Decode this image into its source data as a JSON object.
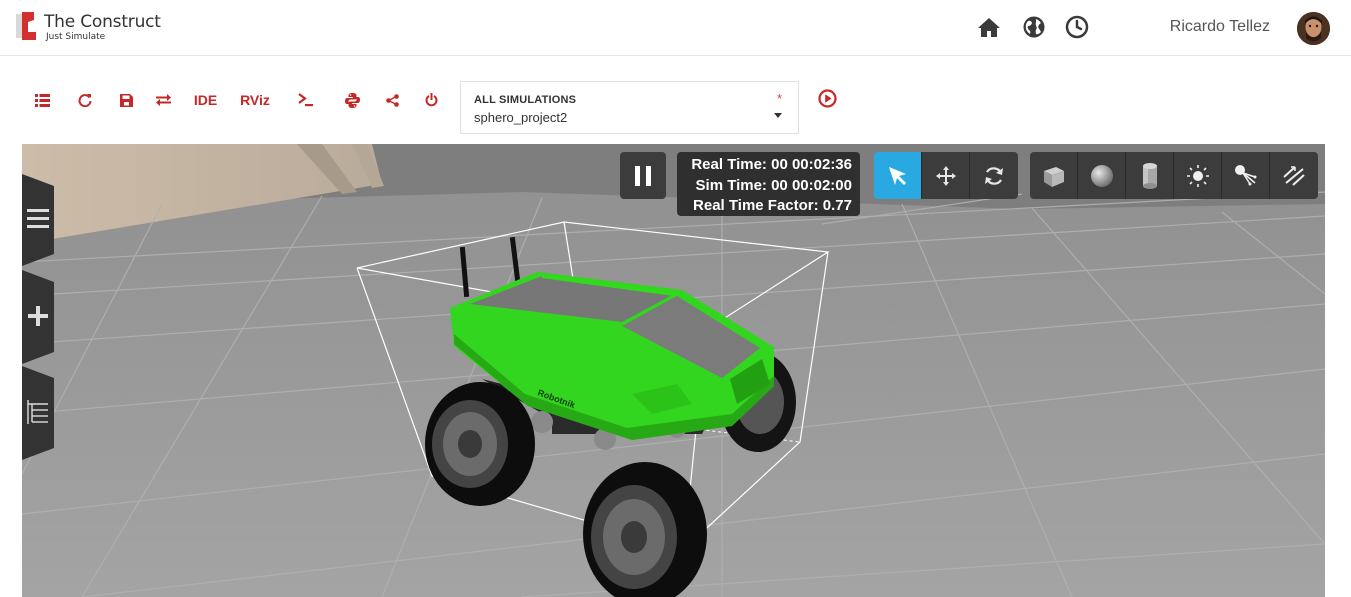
{
  "brand": {
    "title": "The Construct",
    "subtitle": "Just Simulate"
  },
  "header": {
    "icons": [
      "home-icon",
      "globe-icon",
      "clock-icon"
    ],
    "user_name": "Ricardo Tellez"
  },
  "toolbar": {
    "ide_label": "IDE",
    "rviz_label": "RViz",
    "accent": "#c62828",
    "simulation_select": {
      "label": "ALL SIMULATIONS",
      "required_mark": "*",
      "value": "sphero_project2"
    }
  },
  "gazebo": {
    "real_time": "Real Time: 00 00:02:36",
    "sim_time": "Sim Time: 00 00:02:00",
    "real_time_factor": "Real Time Factor: 0.77",
    "active_tool_color": "#29a9e1",
    "tools": [
      "select-tool",
      "translate-tool",
      "rotate-tool"
    ],
    "shapes": [
      "box-shape",
      "sphere-shape",
      "cylinder-shape",
      "point-light",
      "spot-light",
      "directional-light"
    ]
  },
  "robot": {
    "brand_label": "Robotnik",
    "color": "#33d61f"
  }
}
